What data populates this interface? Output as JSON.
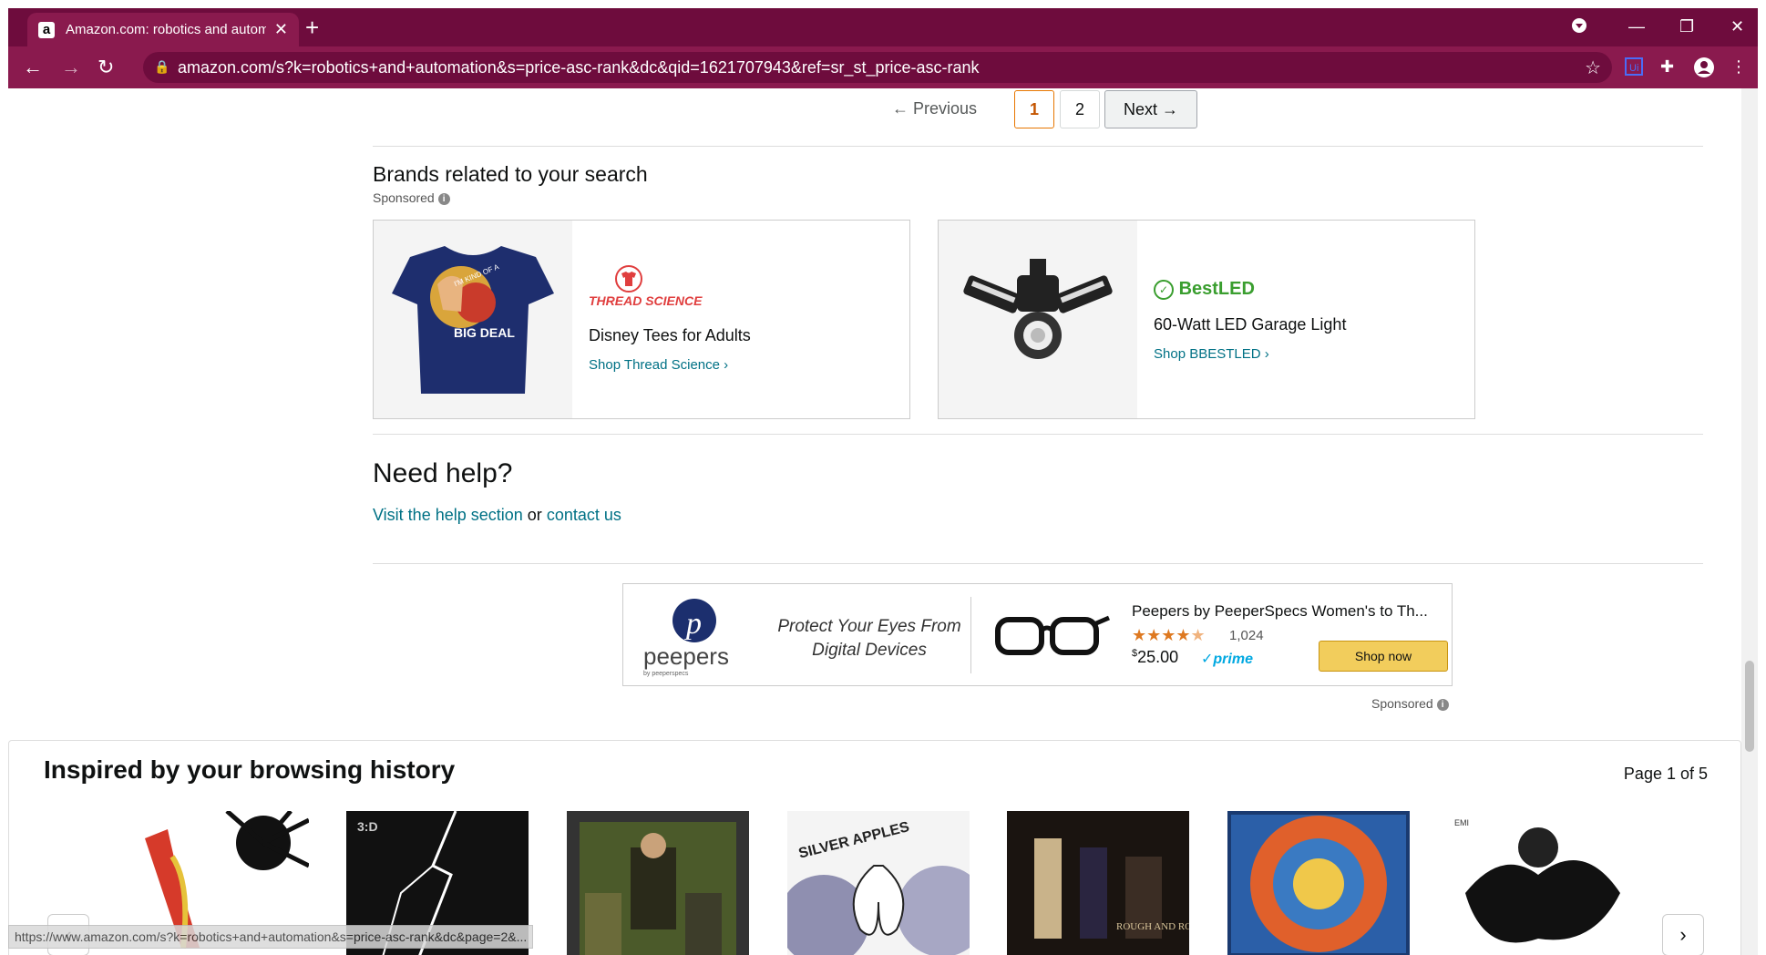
{
  "browser": {
    "tab_title": "Amazon.com: robotics and autom",
    "url": "amazon.com/s?k=robotics+and+automation&s=price-asc-rank&dc&qid=1621707943&ref=sr_st_price-asc-rank",
    "status_url": "https://www.amazon.com/s?k=robotics+and+automation&s=price-asc-rank&dc&page=2&..."
  },
  "pagination": {
    "previous": "Previous",
    "pages": [
      "1",
      "2"
    ],
    "current": "1",
    "next": "Next"
  },
  "brands": {
    "title": "Brands related to your search",
    "sponsored": "Sponsored",
    "cards": [
      {
        "logo": "THREAD SCIENCE",
        "headline": "Disney Tees for Adults",
        "shop": "Shop Thread Science",
        "shirt_text_1": "I'M KIND OF A",
        "shirt_text_2": "BIG DEAL"
      },
      {
        "logo": "BestLED",
        "headline": "60-Watt LED Garage Light",
        "shop": "Shop BBESTLED"
      }
    ]
  },
  "help": {
    "title": "Need help?",
    "link1": "Visit the help section",
    "connector": "or",
    "link2": "contact us"
  },
  "ad": {
    "brand": "peepers",
    "brand_sub": "by peeperspecs",
    "tagline_1": "Protect Your Eyes From",
    "tagline_2": "Digital Devices",
    "product_title": "Peepers by PeeperSpecs Women's to Th...",
    "rating": 4.5,
    "rating_count": "1,024",
    "price_symbol": "$",
    "price": "25.00",
    "prime": "prime",
    "button": "Shop now",
    "sponsored": "Sponsored"
  },
  "history": {
    "title": "Inspired by your browsing history",
    "page_of": "Page 1 of 5",
    "album_texts": [
      "3:D",
      "SILVER APPLES",
      "ROUGH AND ROWDY",
      "EMI"
    ]
  },
  "colors": {
    "chrome_dark": "#6e0c3d",
    "chrome_light": "#8a1a4e",
    "link": "#007185",
    "button_yellow": "#f2cd5c",
    "star_orange": "#de7921"
  }
}
